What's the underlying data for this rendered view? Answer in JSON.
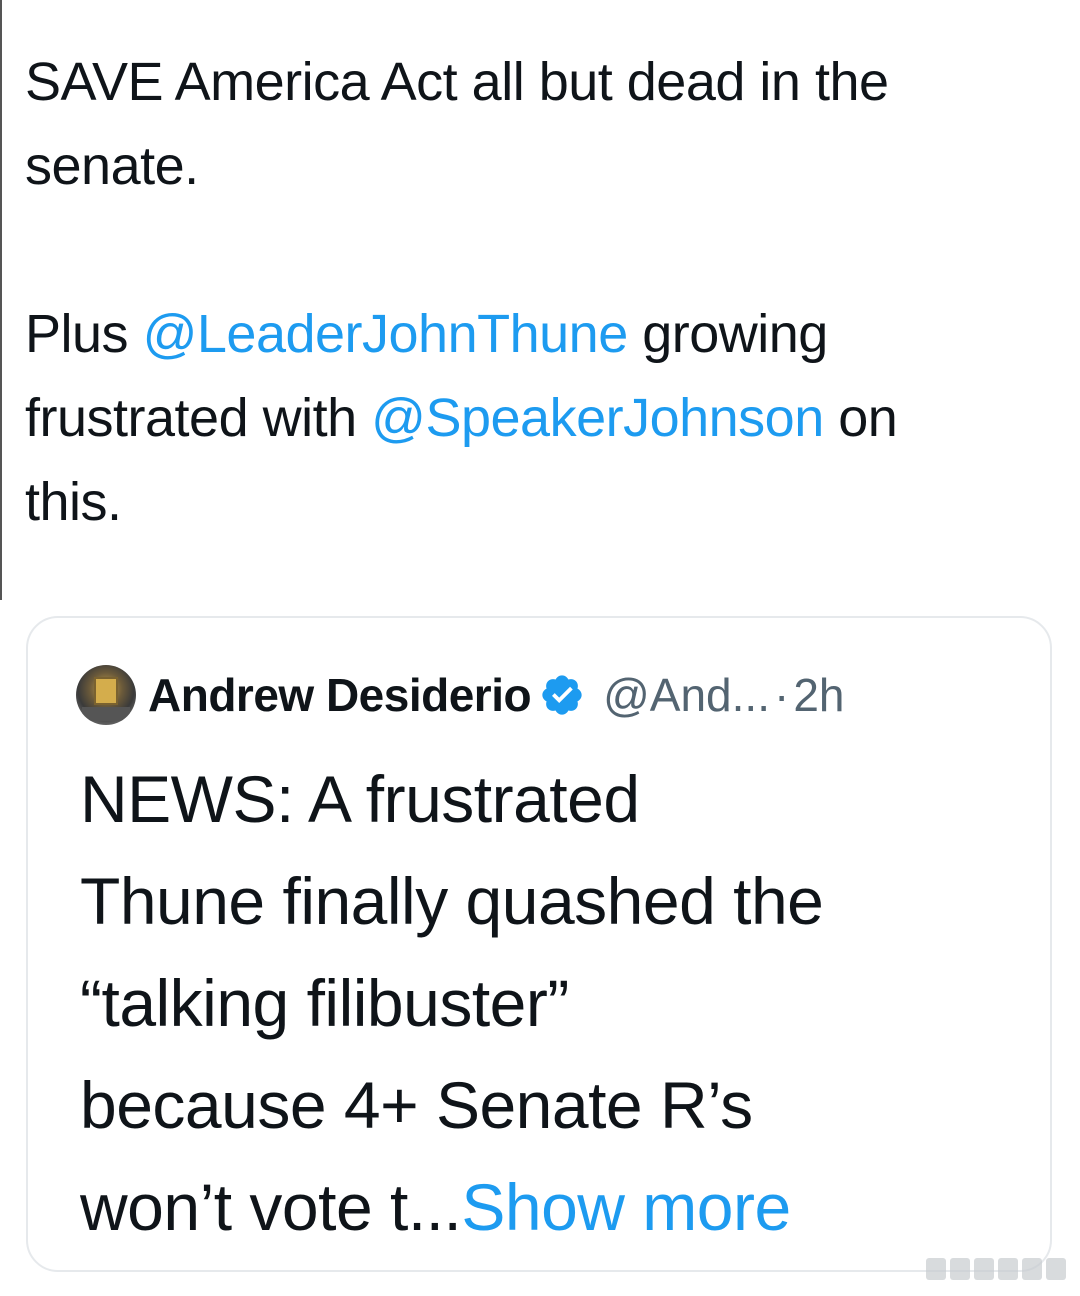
{
  "tweet": {
    "line1": "SAVE America Act all but dead in the",
    "line2": "senate.",
    "para2_prefix": "Plus ",
    "mention1": "@LeaderJohnThune",
    "para2_mid1": " growing",
    "para2_line2_prefix": "frustrated with ",
    "mention2": "@SpeakerJohnson",
    "para2_line2_suffix": " on",
    "para2_line3": "this."
  },
  "quote": {
    "author_name": "Andrew Desiderio",
    "handle": "@And...",
    "dot": "·",
    "time": "2h",
    "body_line1": "NEWS: A frustrated",
    "body_line2": "Thune finally quashed the",
    "body_line3": "“talking filibuster”",
    "body_line4": "because 4+ Senate R’s",
    "body_line5": "won’t vote t...",
    "show_more": "Show more"
  },
  "colors": {
    "text": "#0f1419",
    "link": "#1d9bf0",
    "secondary": "#536471",
    "card_border": "#e6e9ec"
  },
  "icons": {
    "verified": "verified-badge-icon",
    "avatar": "author-avatar"
  }
}
